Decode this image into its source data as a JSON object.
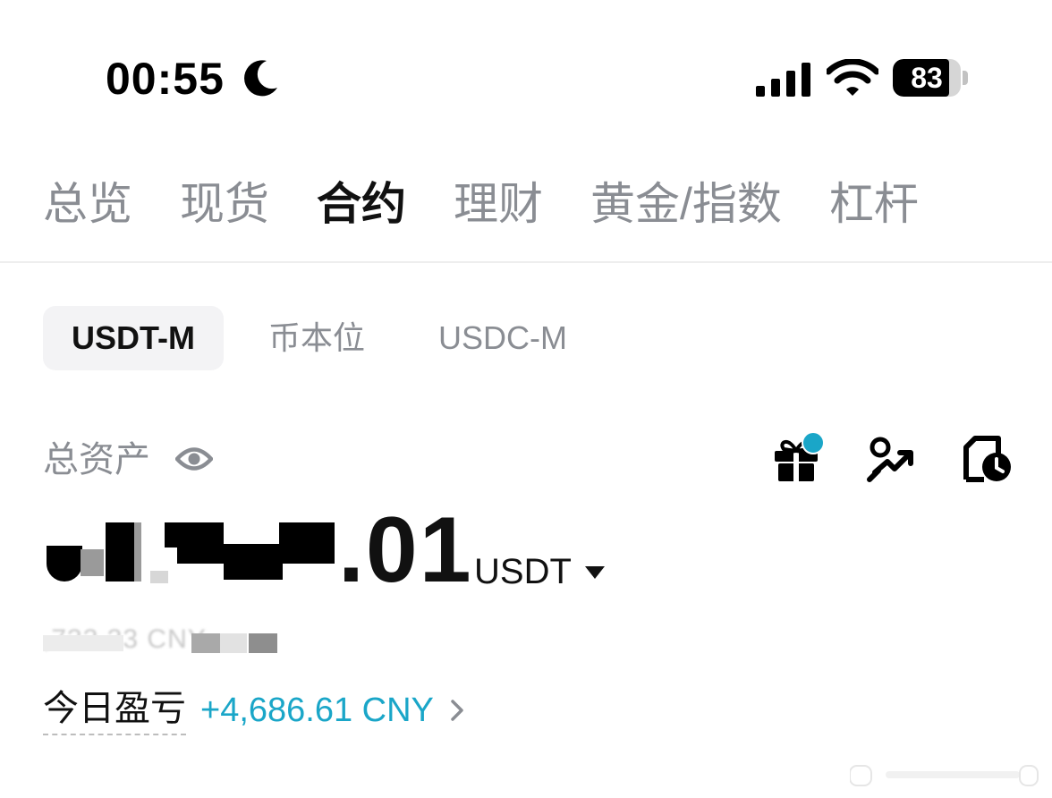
{
  "status_bar": {
    "time": "00:55",
    "battery": "83",
    "battery_level": 0.83
  },
  "main_tabs": [
    {
      "label": "总览",
      "active": false
    },
    {
      "label": "现货",
      "active": false
    },
    {
      "label": "合约",
      "active": true
    },
    {
      "label": "理财",
      "active": false
    },
    {
      "label": "黄金/指数",
      "active": false
    },
    {
      "label": "杠杆",
      "active": false
    }
  ],
  "sub_tabs": [
    {
      "label": "USDT-M",
      "active": true
    },
    {
      "label": "币本位",
      "active": false
    },
    {
      "label": "USDC-M",
      "active": false
    }
  ],
  "asset": {
    "label": "总资产",
    "balance_suffix": ".01",
    "currency": "USDT",
    "converted_suffix": ",733.33 CNY"
  },
  "pnl": {
    "label": "今日盈亏",
    "value": "+4,686.61 CNY"
  },
  "colors": {
    "accent": "#1aa6c8",
    "muted": "#8a8d93",
    "text": "#111111",
    "subtab_bg": "#f3f3f5"
  },
  "icons": {
    "moon": "moon-icon",
    "signal": "signal-icon",
    "wifi": "wifi-icon",
    "eye": "eye-icon",
    "gift": "gift-icon",
    "trend": "trend-icon",
    "history": "history-icon",
    "caret": "caret-down-icon",
    "chevron": "chevron-right-icon"
  }
}
